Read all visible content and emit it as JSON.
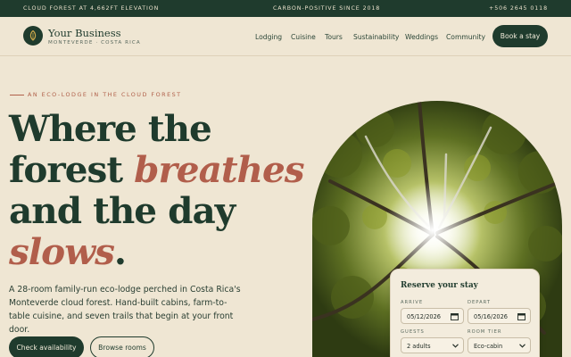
{
  "topbar": {
    "left": "CLOUD FOREST AT 4,662FT ELEVATION",
    "center": "CARBON-POSITIVE SINCE 2018",
    "right": "+506 2645 0118"
  },
  "brand": {
    "name": "Your Business",
    "tagline": "MONTEVERDE · COSTA RICA",
    "icon": "leaf-icon"
  },
  "nav": {
    "links": [
      "Lodging",
      "Cuisine",
      "Tours",
      "Sustainability",
      "Weddings",
      "Community"
    ],
    "cta": "Book a stay"
  },
  "hero": {
    "eyebrow": "AN ECO-LODGE IN THE CLOUD FOREST",
    "headline": {
      "l1": "Where the",
      "l2a": "forest ",
      "l2b": "breathes",
      "l3": "and the day",
      "l4a": "slows",
      "l4b": "."
    },
    "lede": "A 28-room family-run eco-lodge perched in Costa Rica's Monteverde cloud forest. Hand-built cabins, farm-to-table cuisine, and seven trails that begin at your front door.",
    "primary_cta": "Check availability",
    "secondary_cta": "Browse rooms",
    "image_alt": "Sunlight through the cloud forest canopy"
  },
  "booking": {
    "title": "Reserve your stay",
    "arrive_label": "ARRIVE",
    "arrive_value": "05/12/2026",
    "depart_label": "DEPART",
    "depart_value": "05/16/2026",
    "guests_label": "GUESTS",
    "guests_value": "2 adults",
    "tier_label": "ROOM TIER",
    "tier_value": "Eco-cabin"
  },
  "colors": {
    "forest": "#1f3b2d",
    "cream": "#efe6d3",
    "terracotta": "#b15e4b"
  }
}
